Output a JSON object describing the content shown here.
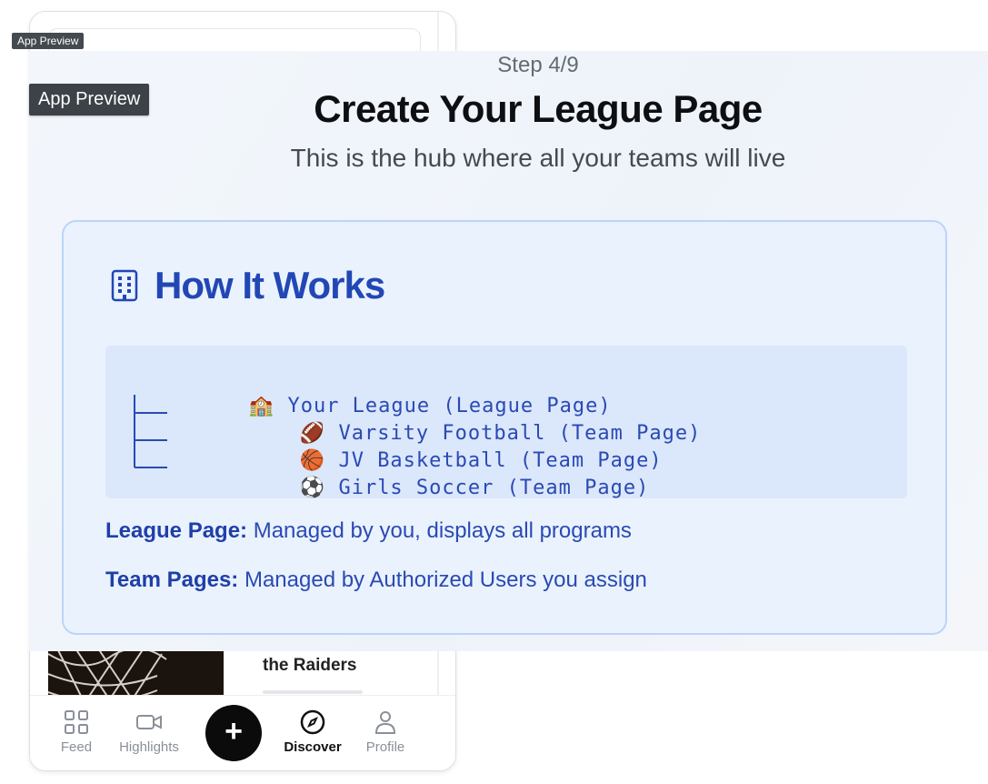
{
  "preview_tag_small": "App Preview",
  "preview_tag_large": "App Preview",
  "phone": {
    "card_title": "the Raiders",
    "tabs": [
      {
        "label": "Feed",
        "icon": "grid-icon"
      },
      {
        "label": "Highlights",
        "icon": "video-icon"
      },
      {
        "label": "+",
        "icon": "plus-icon"
      },
      {
        "label": "Discover",
        "icon": "compass-icon"
      },
      {
        "label": "Profile",
        "icon": "person-icon"
      }
    ]
  },
  "modal": {
    "step": "Step 4/9",
    "title": "Create Your League Page",
    "subtitle": "This is the hub where all your teams will live",
    "card": {
      "heading": "How It Works",
      "heading_icon": "building-icon",
      "tree": [
        {
          "emoji": "🏫",
          "label": "Your League (League Page)"
        },
        {
          "emoji": "🏈",
          "label": "Varsity Football (Team Page)"
        },
        {
          "emoji": "🏀",
          "label": "JV Basketball (Team Page)"
        },
        {
          "emoji": "⚽",
          "label": "Girls Soccer (Team Page)"
        }
      ],
      "league_label": "League Page:",
      "league_text": " Managed by you, displays all programs",
      "team_label": "Team Pages:",
      "team_text": " Managed by Authorized Users you assign"
    }
  },
  "colors": {
    "accent": "#2247b5",
    "card_bg": "#eaf2fe",
    "card_border": "#bcd4fa",
    "tree_bg": "#dbe7fb"
  }
}
